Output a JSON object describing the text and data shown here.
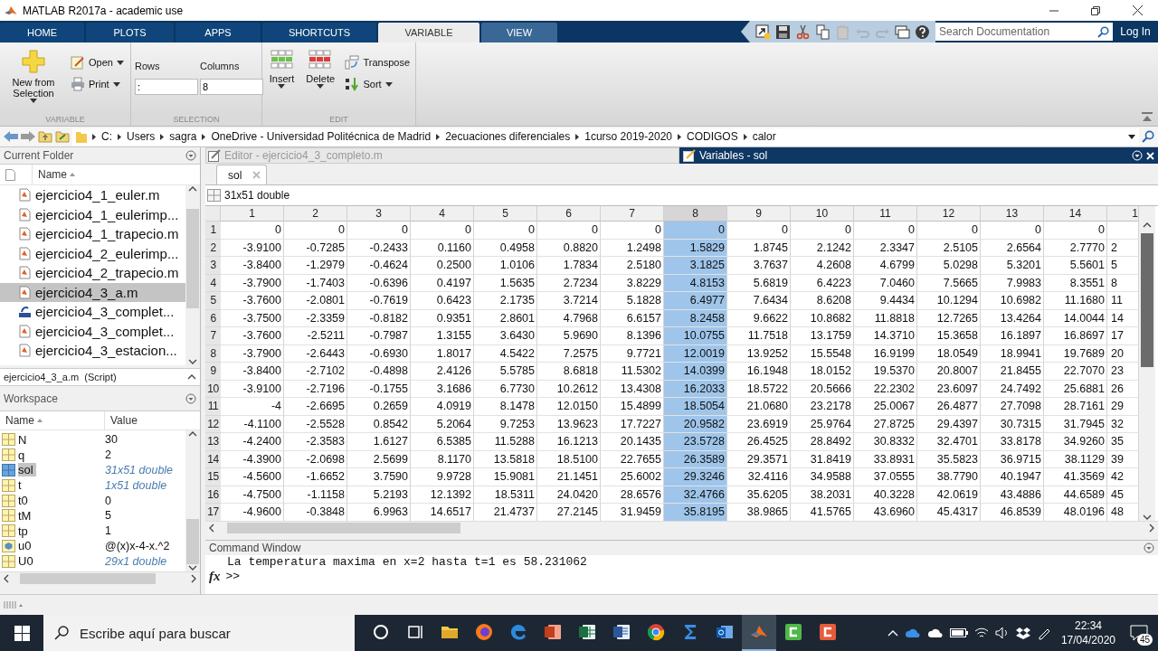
{
  "window": {
    "title": "MATLAB R2017a - academic use"
  },
  "tabs": [
    {
      "label": "HOME",
      "selected": false,
      "contextual": false
    },
    {
      "label": "PLOTS",
      "selected": false,
      "contextual": false
    },
    {
      "label": "APPS",
      "selected": false,
      "contextual": false
    },
    {
      "label": "SHORTCUTS",
      "selected": false,
      "contextual": false
    },
    {
      "label": "VARIABLE",
      "selected": true,
      "contextual": true
    },
    {
      "label": "VIEW",
      "selected": false,
      "contextual": true
    }
  ],
  "search": {
    "placeholder": "Search Documentation"
  },
  "login": "Log In",
  "ribbon": {
    "variable": {
      "label": "VARIABLE",
      "new_from_selection": "New from Selection",
      "open": "Open",
      "print": "Print"
    },
    "selection": {
      "label": "SELECTION",
      "rows_label": "Rows",
      "rows_value": ":",
      "columns_label": "Columns",
      "columns_value": "8"
    },
    "edit": {
      "label": "EDIT",
      "insert": "Insert",
      "delete": "Delete",
      "transpose": "Transpose",
      "sort": "Sort"
    }
  },
  "path": [
    "C:",
    "Users",
    "sagra",
    "OneDrive - Universidad Politécnica de Madrid",
    "2ecuaciones diferenciales",
    "1curso 2019-2020",
    "CODIGOS",
    "calor"
  ],
  "current_folder": {
    "title": "Current Folder",
    "column": "Name",
    "files": [
      {
        "name": "ejercicio4_1_euler.m",
        "kind": "script",
        "selected": false
      },
      {
        "name": "ejercicio4_1_eulerimp...",
        "kind": "script",
        "selected": false
      },
      {
        "name": "ejercicio4_1_trapecio.m",
        "kind": "script",
        "selected": false
      },
      {
        "name": "ejercicio4_2_eulerimp...",
        "kind": "script",
        "selected": false
      },
      {
        "name": "ejercicio4_2_trapecio.m",
        "kind": "script",
        "selected": false
      },
      {
        "name": "ejercicio4_3_a.m",
        "kind": "script",
        "selected": true
      },
      {
        "name": "ejercicio4_3_complet...",
        "kind": "app",
        "selected": false
      },
      {
        "name": "ejercicio4_3_complet...",
        "kind": "script",
        "selected": false
      },
      {
        "name": "ejercicio4_3_estacion...",
        "kind": "script",
        "selected": false
      }
    ],
    "details": "ejercicio4_3_a.m  (Script)"
  },
  "workspace": {
    "title": "Workspace",
    "columns": [
      "Name",
      "Value"
    ],
    "variables": [
      {
        "name": "N",
        "value": "30",
        "kind": "scalar",
        "selected": false
      },
      {
        "name": "q",
        "value": "2",
        "kind": "scalar",
        "selected": false
      },
      {
        "name": "sol",
        "value": "31x51 double",
        "kind": "matrix",
        "selected": true
      },
      {
        "name": "t",
        "value": "1x51 double",
        "kind": "matrix",
        "selected": false
      },
      {
        "name": "t0",
        "value": "0",
        "kind": "scalar",
        "selected": false
      },
      {
        "name": "tM",
        "value": "5",
        "kind": "scalar",
        "selected": false
      },
      {
        "name": "tp",
        "value": "1",
        "kind": "scalar",
        "selected": false
      },
      {
        "name": "u0",
        "value": "@(x)x-4-x.^2",
        "kind": "handle",
        "selected": false
      },
      {
        "name": "U0",
        "value": "29x1 double",
        "kind": "matrix",
        "selected": false
      }
    ]
  },
  "editor": {
    "title": "Editor - ejercicio4_3_completo.m"
  },
  "variables": {
    "title": "Variables - sol",
    "tabs": [
      {
        "label": "sol",
        "selected": true
      }
    ],
    "info": "31x51 double",
    "columns": [
      {
        "label": "1",
        "selected": false,
        "cut": false
      },
      {
        "label": "2",
        "selected": false,
        "cut": false
      },
      {
        "label": "3",
        "selected": false,
        "cut": false
      },
      {
        "label": "4",
        "selected": false,
        "cut": false
      },
      {
        "label": "5",
        "selected": false,
        "cut": false
      },
      {
        "label": "6",
        "selected": false,
        "cut": false
      },
      {
        "label": "7",
        "selected": false,
        "cut": false
      },
      {
        "label": "8",
        "selected": true,
        "cut": false
      },
      {
        "label": "9",
        "selected": false,
        "cut": false
      },
      {
        "label": "10",
        "selected": false,
        "cut": false
      },
      {
        "label": "11",
        "selected": false,
        "cut": false
      },
      {
        "label": "12",
        "selected": false,
        "cut": false
      },
      {
        "label": "13",
        "selected": false,
        "cut": false
      },
      {
        "label": "14",
        "selected": false,
        "cut": false
      },
      {
        "label": "1",
        "selected": false,
        "cut": true
      }
    ],
    "rows": [
      {
        "header": "1",
        "cells": [
          "0",
          "0",
          "0",
          "0",
          "0",
          "0",
          "0",
          "0",
          "0",
          "0",
          "0",
          "0",
          "0",
          "0"
        ]
      },
      {
        "header": "2",
        "cells": [
          "-3.9100",
          "-0.7285",
          "-0.2433",
          "0.1160",
          "0.4958",
          "0.8820",
          "1.2498",
          "1.5829",
          "1.8745",
          "2.1242",
          "2.3347",
          "2.5105",
          "2.6564",
          "2.7770",
          "2"
        ]
      },
      {
        "header": "3",
        "cells": [
          "-3.8400",
          "-1.2979",
          "-0.4624",
          "0.2500",
          "1.0106",
          "1.7834",
          "2.5180",
          "3.1825",
          "3.7637",
          "4.2608",
          "4.6799",
          "5.0298",
          "5.3201",
          "5.5601",
          "5"
        ]
      },
      {
        "header": "4",
        "cells": [
          "-3.7900",
          "-1.7403",
          "-0.6396",
          "0.4197",
          "1.5635",
          "2.7234",
          "3.8229",
          "4.8153",
          "5.6819",
          "6.4223",
          "7.0460",
          "7.5665",
          "7.9983",
          "8.3551",
          "8"
        ]
      },
      {
        "header": "5",
        "cells": [
          "-3.7600",
          "-2.0801",
          "-0.7619",
          "0.6423",
          "2.1735",
          "3.7214",
          "5.1828",
          "6.4977",
          "7.6434",
          "8.6208",
          "9.4434",
          "10.1294",
          "10.6982",
          "11.1680",
          "11"
        ]
      },
      {
        "header": "6",
        "cells": [
          "-3.7500",
          "-2.3359",
          "-0.8182",
          "0.9351",
          "2.8601",
          "4.7968",
          "6.6157",
          "8.2458",
          "9.6622",
          "10.8682",
          "11.8818",
          "12.7265",
          "13.4264",
          "14.0044",
          "14"
        ]
      },
      {
        "header": "7",
        "cells": [
          "-3.7600",
          "-2.5211",
          "-0.7987",
          "1.3155",
          "3.6430",
          "5.9690",
          "8.1396",
          "10.0755",
          "11.7518",
          "13.1759",
          "14.3710",
          "15.3658",
          "16.1897",
          "16.8697",
          "17"
        ]
      },
      {
        "header": "8",
        "cells": [
          "-3.7900",
          "-2.6443",
          "-0.6930",
          "1.8017",
          "4.5422",
          "7.2575",
          "9.7721",
          "12.0019",
          "13.9252",
          "15.5548",
          "16.9199",
          "18.0549",
          "18.9941",
          "19.7689",
          "20"
        ]
      },
      {
        "header": "9",
        "cells": [
          "-3.8400",
          "-2.7102",
          "-0.4898",
          "2.4126",
          "5.5785",
          "8.6818",
          "11.5302",
          "14.0399",
          "16.1948",
          "18.0152",
          "19.5370",
          "20.8007",
          "21.8455",
          "22.7070",
          "23"
        ]
      },
      {
        "header": "10",
        "cells": [
          "-3.9100",
          "-2.7196",
          "-0.1755",
          "3.1686",
          "6.7730",
          "10.2612",
          "13.4308",
          "16.2033",
          "18.5722",
          "20.5666",
          "22.2302",
          "23.6097",
          "24.7492",
          "25.6881",
          "26"
        ]
      },
      {
        "header": "11",
        "cells": [
          "-4",
          "-2.6695",
          "0.2659",
          "4.0919",
          "8.1478",
          "12.0150",
          "15.4899",
          "18.5054",
          "21.0680",
          "23.2178",
          "25.0067",
          "26.4877",
          "27.7098",
          "28.7161",
          "29"
        ]
      },
      {
        "header": "12",
        "cells": [
          "-4.1100",
          "-2.5528",
          "0.8542",
          "5.2064",
          "9.7253",
          "13.9623",
          "17.7227",
          "20.9582",
          "23.6919",
          "25.9764",
          "27.8725",
          "29.4397",
          "30.7315",
          "31.7945",
          "32"
        ]
      },
      {
        "header": "13",
        "cells": [
          "-4.2400",
          "-2.3583",
          "1.6127",
          "6.5385",
          "11.5288",
          "16.1213",
          "20.1435",
          "23.5728",
          "26.4525",
          "28.8492",
          "30.8332",
          "32.4701",
          "33.8178",
          "34.9260",
          "35"
        ]
      },
      {
        "header": "14",
        "cells": [
          "-4.3900",
          "-2.0698",
          "2.5699",
          "8.1170",
          "13.5818",
          "18.5100",
          "22.7655",
          "26.3589",
          "29.3571",
          "31.8419",
          "33.8931",
          "35.5823",
          "36.9715",
          "38.1129",
          "39"
        ]
      },
      {
        "header": "15",
        "cells": [
          "-4.5600",
          "-1.6652",
          "3.7590",
          "9.9728",
          "15.9081",
          "21.1451",
          "25.6002",
          "29.3246",
          "32.4116",
          "34.9588",
          "37.0555",
          "38.7790",
          "40.1947",
          "41.3569",
          "42"
        ]
      },
      {
        "header": "16",
        "cells": [
          "-4.7500",
          "-1.1158",
          "5.2193",
          "12.1392",
          "18.5311",
          "24.0420",
          "28.6576",
          "32.4766",
          "35.6205",
          "38.2031",
          "40.3228",
          "42.0619",
          "43.4886",
          "44.6589",
          "45"
        ]
      },
      {
        "header": "17",
        "cells": [
          "-4.9600",
          "-0.3848",
          "6.9963",
          "14.6517",
          "21.4737",
          "27.2145",
          "31.9459",
          "35.8195",
          "38.9865",
          "41.5765",
          "43.6960",
          "45.4317",
          "46.8539",
          "48.0196",
          "48"
        ]
      }
    ]
  },
  "command_window": {
    "title": "Command Window",
    "output": [
      "La temperatura maxima en x=2 hasta t=1 es 58.231062"
    ],
    "prompt_icon": "fx",
    "prompt": ">>"
  },
  "taskbar": {
    "search_placeholder": "Escribe aquí para buscar",
    "apps": [
      {
        "kind": "cortana",
        "selected": false
      },
      {
        "kind": "taskview",
        "selected": false
      },
      {
        "kind": "explorer",
        "selected": false
      },
      {
        "kind": "firefox",
        "selected": false
      },
      {
        "kind": "edge",
        "selected": false
      },
      {
        "kind": "powerpoint",
        "selected": false
      },
      {
        "kind": "excel",
        "selected": false
      },
      {
        "kind": "word",
        "selected": false
      },
      {
        "kind": "chrome",
        "selected": false
      },
      {
        "kind": "sigma",
        "selected": false
      },
      {
        "kind": "outlook",
        "selected": false
      },
      {
        "kind": "matlab",
        "selected": true
      },
      {
        "kind": "green",
        "selected": false
      },
      {
        "kind": "red",
        "selected": false
      }
    ],
    "time": "22:34",
    "date": "17/04/2020",
    "notifications": "45"
  }
}
